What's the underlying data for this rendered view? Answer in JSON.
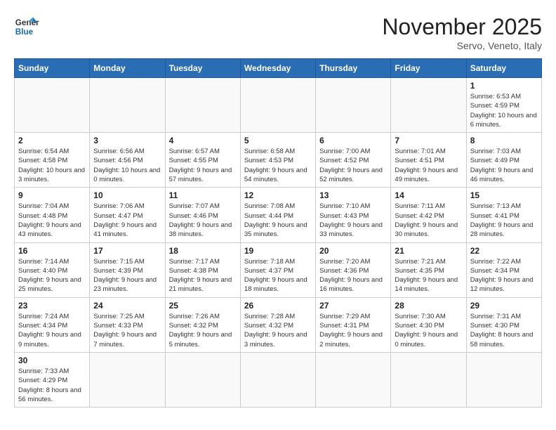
{
  "header": {
    "logo_general": "General",
    "logo_blue": "Blue",
    "title": "November 2025",
    "subtitle": "Servo, Veneto, Italy"
  },
  "weekdays": [
    "Sunday",
    "Monday",
    "Tuesday",
    "Wednesday",
    "Thursday",
    "Friday",
    "Saturday"
  ],
  "weeks": [
    [
      {
        "day": "",
        "info": ""
      },
      {
        "day": "",
        "info": ""
      },
      {
        "day": "",
        "info": ""
      },
      {
        "day": "",
        "info": ""
      },
      {
        "day": "",
        "info": ""
      },
      {
        "day": "",
        "info": ""
      },
      {
        "day": "1",
        "info": "Sunrise: 6:53 AM\nSunset: 4:59 PM\nDaylight: 10 hours and 6 minutes."
      }
    ],
    [
      {
        "day": "2",
        "info": "Sunrise: 6:54 AM\nSunset: 4:58 PM\nDaylight: 10 hours and 3 minutes."
      },
      {
        "day": "3",
        "info": "Sunrise: 6:56 AM\nSunset: 4:56 PM\nDaylight: 10 hours and 0 minutes."
      },
      {
        "day": "4",
        "info": "Sunrise: 6:57 AM\nSunset: 4:55 PM\nDaylight: 9 hours and 57 minutes."
      },
      {
        "day": "5",
        "info": "Sunrise: 6:58 AM\nSunset: 4:53 PM\nDaylight: 9 hours and 54 minutes."
      },
      {
        "day": "6",
        "info": "Sunrise: 7:00 AM\nSunset: 4:52 PM\nDaylight: 9 hours and 52 minutes."
      },
      {
        "day": "7",
        "info": "Sunrise: 7:01 AM\nSunset: 4:51 PM\nDaylight: 9 hours and 49 minutes."
      },
      {
        "day": "8",
        "info": "Sunrise: 7:03 AM\nSunset: 4:49 PM\nDaylight: 9 hours and 46 minutes."
      }
    ],
    [
      {
        "day": "9",
        "info": "Sunrise: 7:04 AM\nSunset: 4:48 PM\nDaylight: 9 hours and 43 minutes."
      },
      {
        "day": "10",
        "info": "Sunrise: 7:06 AM\nSunset: 4:47 PM\nDaylight: 9 hours and 41 minutes."
      },
      {
        "day": "11",
        "info": "Sunrise: 7:07 AM\nSunset: 4:46 PM\nDaylight: 9 hours and 38 minutes."
      },
      {
        "day": "12",
        "info": "Sunrise: 7:08 AM\nSunset: 4:44 PM\nDaylight: 9 hours and 35 minutes."
      },
      {
        "day": "13",
        "info": "Sunrise: 7:10 AM\nSunset: 4:43 PM\nDaylight: 9 hours and 33 minutes."
      },
      {
        "day": "14",
        "info": "Sunrise: 7:11 AM\nSunset: 4:42 PM\nDaylight: 9 hours and 30 minutes."
      },
      {
        "day": "15",
        "info": "Sunrise: 7:13 AM\nSunset: 4:41 PM\nDaylight: 9 hours and 28 minutes."
      }
    ],
    [
      {
        "day": "16",
        "info": "Sunrise: 7:14 AM\nSunset: 4:40 PM\nDaylight: 9 hours and 25 minutes."
      },
      {
        "day": "17",
        "info": "Sunrise: 7:15 AM\nSunset: 4:39 PM\nDaylight: 9 hours and 23 minutes."
      },
      {
        "day": "18",
        "info": "Sunrise: 7:17 AM\nSunset: 4:38 PM\nDaylight: 9 hours and 21 minutes."
      },
      {
        "day": "19",
        "info": "Sunrise: 7:18 AM\nSunset: 4:37 PM\nDaylight: 9 hours and 18 minutes."
      },
      {
        "day": "20",
        "info": "Sunrise: 7:20 AM\nSunset: 4:36 PM\nDaylight: 9 hours and 16 minutes."
      },
      {
        "day": "21",
        "info": "Sunrise: 7:21 AM\nSunset: 4:35 PM\nDaylight: 9 hours and 14 minutes."
      },
      {
        "day": "22",
        "info": "Sunrise: 7:22 AM\nSunset: 4:34 PM\nDaylight: 9 hours and 12 minutes."
      }
    ],
    [
      {
        "day": "23",
        "info": "Sunrise: 7:24 AM\nSunset: 4:34 PM\nDaylight: 9 hours and 9 minutes."
      },
      {
        "day": "24",
        "info": "Sunrise: 7:25 AM\nSunset: 4:33 PM\nDaylight: 9 hours and 7 minutes."
      },
      {
        "day": "25",
        "info": "Sunrise: 7:26 AM\nSunset: 4:32 PM\nDaylight: 9 hours and 5 minutes."
      },
      {
        "day": "26",
        "info": "Sunrise: 7:28 AM\nSunset: 4:32 PM\nDaylight: 9 hours and 3 minutes."
      },
      {
        "day": "27",
        "info": "Sunrise: 7:29 AM\nSunset: 4:31 PM\nDaylight: 9 hours and 2 minutes."
      },
      {
        "day": "28",
        "info": "Sunrise: 7:30 AM\nSunset: 4:30 PM\nDaylight: 9 hours and 0 minutes."
      },
      {
        "day": "29",
        "info": "Sunrise: 7:31 AM\nSunset: 4:30 PM\nDaylight: 8 hours and 58 minutes."
      }
    ],
    [
      {
        "day": "30",
        "info": "Sunrise: 7:33 AM\nSunset: 4:29 PM\nDaylight: 8 hours and 56 minutes."
      },
      {
        "day": "",
        "info": ""
      },
      {
        "day": "",
        "info": ""
      },
      {
        "day": "",
        "info": ""
      },
      {
        "day": "",
        "info": ""
      },
      {
        "day": "",
        "info": ""
      },
      {
        "day": "",
        "info": ""
      }
    ]
  ]
}
